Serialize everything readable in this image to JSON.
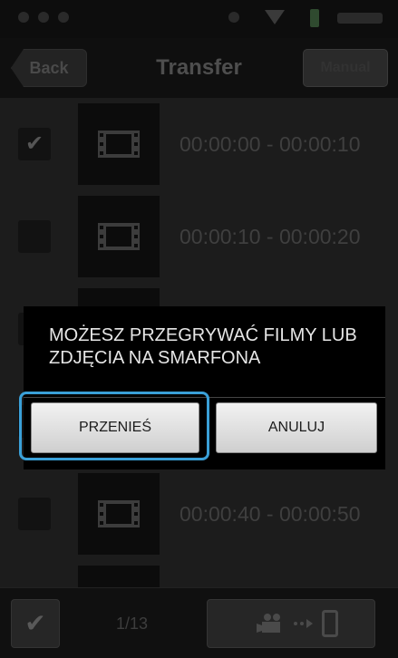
{
  "nav": {
    "back_label": "Back",
    "title": "Transfer",
    "manual_label": "Manual"
  },
  "list": {
    "items": [
      {
        "time_range": "00:00:00 - 00:00:10",
        "checked": true
      },
      {
        "time_range": "00:00:10 - 00:00:20",
        "checked": false
      },
      {
        "time_range": "",
        "checked": false
      },
      {
        "time_range": "",
        "checked": false
      },
      {
        "time_range": "00:00:40 - 00:00:50",
        "checked": false
      }
    ]
  },
  "dialog": {
    "message": "MOŻESZ PRZEGRYWAĆ FILMY LUB ZDJĘCIA NA SMARFONA",
    "transfer_label": "PRZENIEŚ",
    "cancel_label": "ANULUJ"
  },
  "bottom_bar": {
    "page_counter": "1/13",
    "select_all_icon": "checkmark-icon",
    "send_icons": [
      "camera-icon",
      "arrow-dots-icon",
      "smartphone-icon"
    ]
  },
  "colors": {
    "highlight": "#3aa0d8",
    "dialog_bg": "#000000",
    "button_bg": "#e6e6e6"
  }
}
